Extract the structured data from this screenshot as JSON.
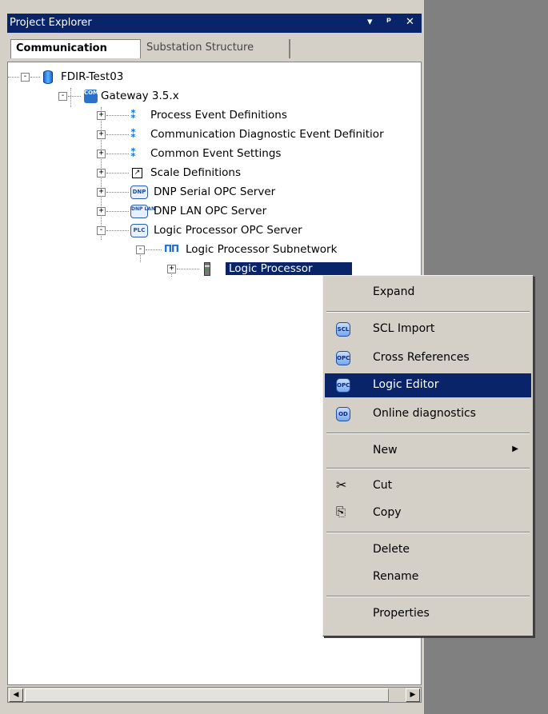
{
  "panel": {
    "title": "Project Explorer",
    "controls": {
      "dropdown": "▾",
      "pin": "ᵖ",
      "close": "✕"
    },
    "tabs": [
      {
        "label": "Communication"
      },
      {
        "label": "Substation Structure"
      }
    ]
  },
  "tree": [
    {
      "label": "FDIR-Test03",
      "icon": "database-icon"
    },
    {
      "label": "Gateway 3.5.x",
      "icon": "gateway-icon",
      "icon_text": "COM 600"
    },
    {
      "label": "Process Event Definitions",
      "icon": "event-icon"
    },
    {
      "label": "Communication Diagnostic Event Definitior",
      "icon": "event-icon"
    },
    {
      "label": "Common Event Settings",
      "icon": "event-icon"
    },
    {
      "label": "Scale Definitions",
      "icon": "scale-icon"
    },
    {
      "label": "DNP Serial OPC Server",
      "icon": "dnp-serial-icon",
      "icon_text": "DNP"
    },
    {
      "label": "DNP LAN OPC Server",
      "icon": "dnp-lan-icon",
      "icon_text": "DNP LAN"
    },
    {
      "label": "Logic Processor OPC Server",
      "icon": "plc-icon",
      "icon_text": "PLC"
    },
    {
      "label": "Logic Processor Subnetwork",
      "icon": "subnetwork-icon"
    },
    {
      "label": "Logic Processor",
      "icon": "device-icon"
    }
  ],
  "context_menu": {
    "items": [
      {
        "label": "Expand"
      },
      {
        "label": "SCL Import",
        "icon_text": "SCL"
      },
      {
        "label": "Cross References",
        "icon_text": "OPC"
      },
      {
        "label": "Logic Editor",
        "icon_text": "OPC",
        "highlighted": true
      },
      {
        "label": "Online diagnostics",
        "icon_text": "OD"
      },
      {
        "label": "New"
      },
      {
        "label": "Cut"
      },
      {
        "label": "Copy"
      },
      {
        "label": "Delete"
      },
      {
        "label": "Rename"
      },
      {
        "label": "Properties"
      }
    ]
  },
  "colors": {
    "selection": "#0a246a",
    "panel_bg": "#d4d0c8",
    "workspace_bg": "#808080"
  }
}
